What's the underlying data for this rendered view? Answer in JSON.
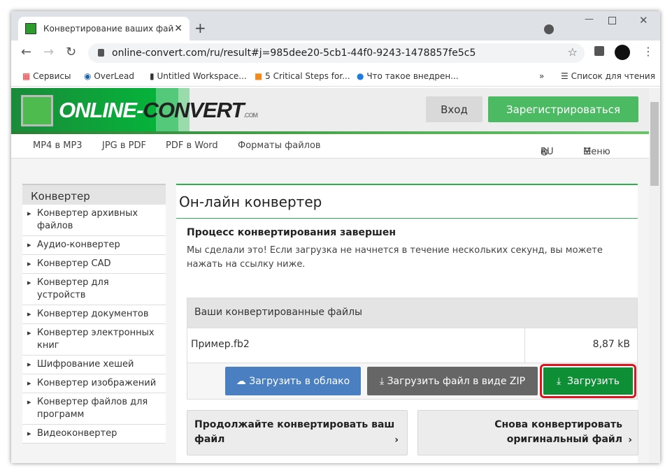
{
  "browser": {
    "tab_title": "Конвертирование ваших файлов",
    "url": "online-convert.com/ru/result#j=985dee20-5cb1-44f0-9243-1478857fe5c5",
    "bookmarks": [
      "Сервисы",
      "OverLead",
      "Untitled Workspace...",
      "5 Critical Steps for...",
      "Что такое внедрен..."
    ],
    "reading_list": "Список для чтения",
    "more": "»"
  },
  "header": {
    "logo_text_white": "ONLINE-",
    "logo_text_dark": "CONVERT",
    "logo_com": ".COM",
    "login": "Вход",
    "register": "Зарегистрироваться"
  },
  "nav": {
    "items": [
      "MP4 в MP3",
      "JPG в PDF",
      "PDF в Word",
      "Форматы файлов"
    ],
    "lang": "RU",
    "menu": "Меню"
  },
  "sidebar": {
    "title": "Конвертер",
    "items": [
      "Конвертер архивных файлов",
      "Аудио-конвертер",
      "Конвертер CAD",
      "Конвертер для устройств",
      "Конвертер документов",
      "Конвертер электронных книг",
      "Шифрование хешей",
      "Конвертер изображений",
      "Конвертер файлов для программ",
      "Видеоконвертер"
    ]
  },
  "main": {
    "title": "Он-лайн конвертер",
    "status_title": "Процесс конвертирования завершен",
    "status_text": "Мы сделали это! Если загрузка не начнется в течение нескольких секунд, вы можете нажать на ссылку ниже.",
    "files_header": "Ваши конвертированные файлы",
    "file": {
      "name": "Пример.fb2",
      "size": "8,87 kB"
    },
    "btn_cloud": "Загрузить в облако",
    "btn_zip": "Загрузить файл в виде ZIP",
    "btn_download": "Загрузить",
    "continue": "Продолжайте конвертировать ваш файл",
    "again": "Снова конвертировать оригинальный файл"
  },
  "colors": {
    "green": "#0f8f35",
    "blue": "#4a7fc1",
    "gray": "#666666",
    "highlight": "#e0141e"
  }
}
